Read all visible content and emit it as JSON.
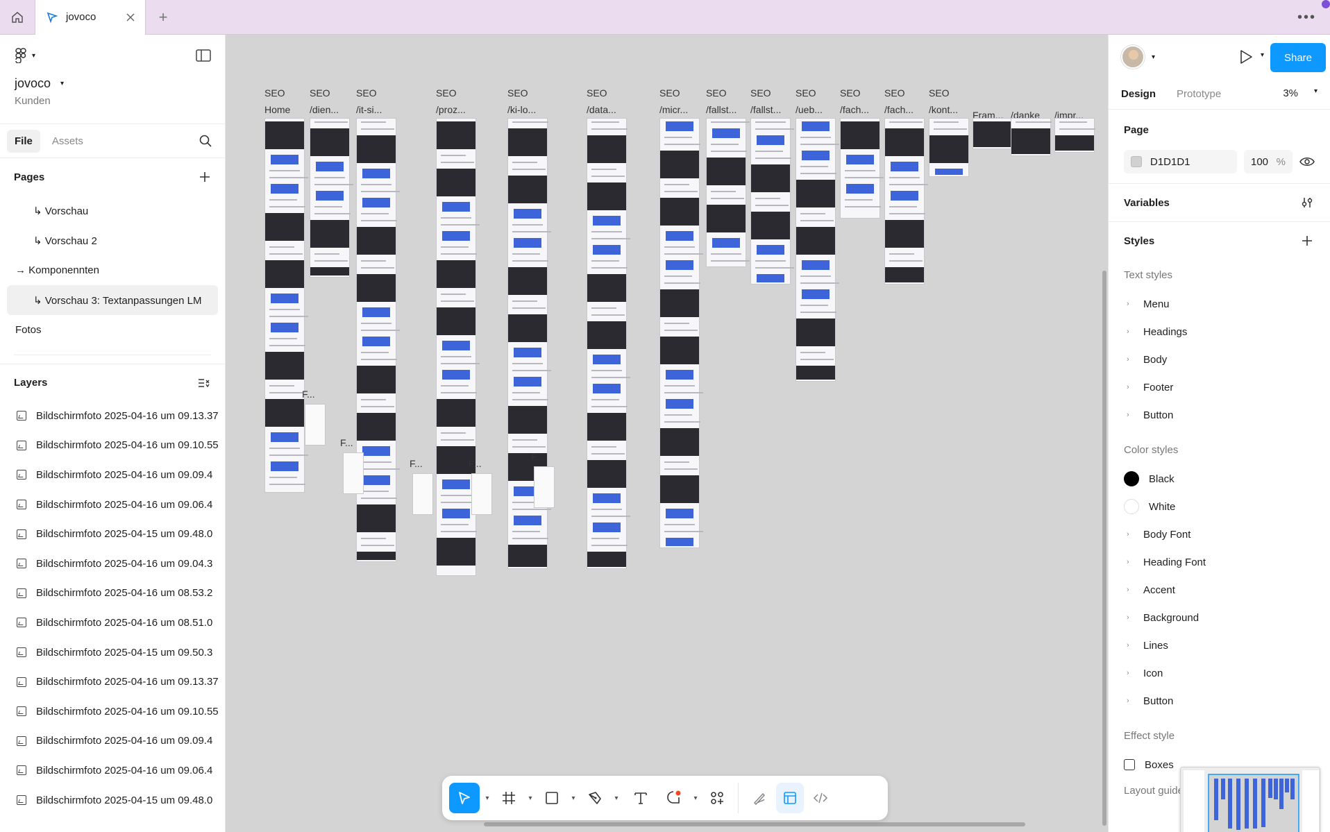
{
  "titlebar": {
    "tab_title": "jovoco"
  },
  "left": {
    "project_name": "jovoco",
    "team_name": "Kunden",
    "tabs": [
      "File",
      "Assets"
    ],
    "pages_title": "Pages",
    "pages": [
      {
        "label": "↳ Vorschau",
        "indent": true,
        "active": false
      },
      {
        "label": "↳ Vorschau 2",
        "indent": true,
        "active": false
      },
      {
        "label": "→ Komponennten",
        "indent": false,
        "active": false
      },
      {
        "label": "↳ Vorschau 3: Textanpassungen LM",
        "indent": true,
        "active": true
      },
      {
        "label": "Fotos",
        "indent": false,
        "active": false
      }
    ],
    "layers_title": "Layers",
    "layers": [
      "Bildschirmfoto 2025-04-16 um 09.13.37",
      "Bildschirmfoto 2025-04-16 um 09.10.55",
      "Bildschirmfoto 2025-04-16 um 09.09.4",
      "Bildschirmfoto 2025-04-16 um 09.06.4",
      "Bildschirmfoto 2025-04-15 um 09.48.0",
      "Bildschirmfoto 2025-04-16 um 09.04.3",
      "Bildschirmfoto 2025-04-16 um 08.53.2",
      "Bildschirmfoto 2025-04-16 um 08.51.0",
      "Bildschirmfoto 2025-04-15 um 09.50.3",
      "Bildschirmfoto 2025-04-16 um 09.13.37",
      "Bildschirmfoto 2025-04-16 um 09.10.55",
      "Bildschirmfoto 2025-04-16 um 09.09.4",
      "Bildschirmfoto 2025-04-16 um 09.06.4",
      "Bildschirmfoto 2025-04-15 um 09.48.0"
    ]
  },
  "canvas": {
    "columns": [
      {
        "seo": "SEO",
        "name": "Home",
        "h": 540
      },
      {
        "seo": "SEO",
        "name": "/dien...",
        "h": 230
      },
      {
        "seo": "SEO",
        "name": "/it-si...",
        "h": 640
      },
      {
        "seo": "SEO",
        "name": "/proz...",
        "h": 660
      },
      {
        "seo": "SEO",
        "name": "/ki-lo...",
        "h": 650
      },
      {
        "seo": "SEO",
        "name": "/data...",
        "h": 650
      },
      {
        "seo": "SEO",
        "name": "/micr...",
        "h": 620
      },
      {
        "seo": "SEO",
        "name": "/fallst...",
        "h": 215
      },
      {
        "seo": "SEO",
        "name": "/fallst...",
        "h": 240
      },
      {
        "seo": "SEO",
        "name": "/ueb...",
        "h": 380
      },
      {
        "seo": "SEO",
        "name": "/fach...",
        "h": 145
      },
      {
        "seo": "SEO",
        "name": "/fach...",
        "h": 240
      },
      {
        "seo": "SEO",
        "name": "/kont...",
        "h": 85
      },
      {
        "seo": "",
        "name": "Fram...",
        "h": 45
      },
      {
        "seo": "",
        "name": "/danke",
        "h": 55
      },
      {
        "seo": "",
        "name": "/impr...",
        "h": 50
      }
    ],
    "side_labels": [
      "F...",
      "...",
      "F...",
      "F...",
      "F...",
      "F..."
    ]
  },
  "right": {
    "share_label": "Share",
    "tabs": [
      "Design",
      "Prototype"
    ],
    "zoom": "3%",
    "page_title": "Page",
    "page_color_hex": "D1D1D1",
    "page_opacity": "100",
    "page_opacity_unit": "%",
    "variables_title": "Variables",
    "styles_title": "Styles",
    "text_styles_title": "Text styles",
    "text_styles": [
      "Menu",
      "Headings",
      "Body",
      "Footer",
      "Button"
    ],
    "color_styles_title": "Color styles",
    "color_styles": [
      {
        "label": "Black",
        "swatch": "#000000"
      },
      {
        "label": "White",
        "swatch": "#ffffff"
      },
      {
        "label": "Body Font",
        "swatch": ""
      },
      {
        "label": "Heading Font",
        "swatch": ""
      },
      {
        "label": "Accent",
        "swatch": ""
      },
      {
        "label": "Background",
        "swatch": ""
      },
      {
        "label": "Lines",
        "swatch": ""
      },
      {
        "label": "Icon",
        "swatch": ""
      },
      {
        "label": "Button",
        "swatch": ""
      }
    ],
    "effect_styles_title": "Effect style",
    "effect_styles": [
      "Boxes"
    ],
    "layout_guide_title": "Layout guide styles"
  },
  "colors": {
    "accent": "#0d99ff",
    "titlebar": "#ecdcf0",
    "canvas": "#d4d4d4"
  }
}
